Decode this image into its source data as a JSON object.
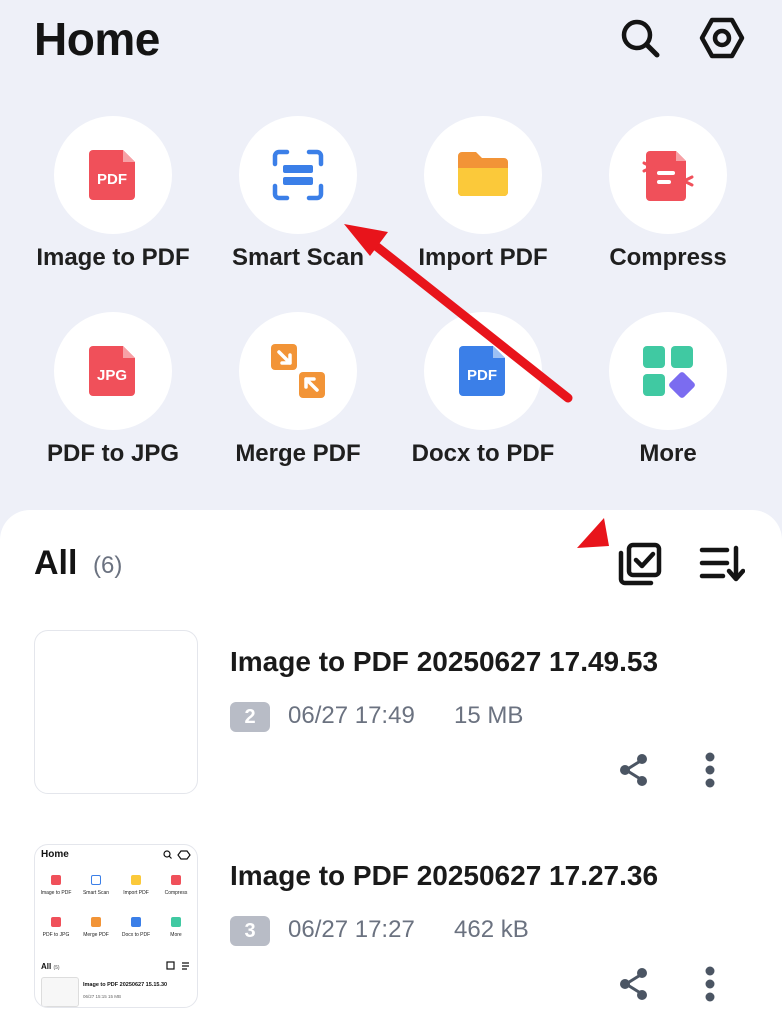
{
  "header": {
    "title": "Home",
    "search_icon": "search-icon",
    "settings_icon": "hexagon-gear-icon"
  },
  "tools": [
    {
      "label": "Image to PDF",
      "icon": "pdf-file-icon",
      "color": "#f0505a"
    },
    {
      "label": "Smart Scan",
      "icon": "scan-frame-icon",
      "color": "#3b7fe8"
    },
    {
      "label": "Import PDF",
      "icon": "folder-icon",
      "color": "#f7b733"
    },
    {
      "label": "Compress",
      "icon": "compress-file-icon",
      "color": "#f0505a"
    },
    {
      "label": "PDF to JPG",
      "icon": "jpg-file-icon",
      "color": "#f0505a"
    },
    {
      "label": "Merge PDF",
      "icon": "merge-arrows-icon",
      "color": "#f29437"
    },
    {
      "label": "Docx to PDF",
      "icon": "pdf-doc-icon",
      "color": "#3b7fe8"
    },
    {
      "label": "More",
      "icon": "grid-more-icon",
      "color": "#40c9a2"
    }
  ],
  "tool_icon_text": {
    "pdf": "PDF",
    "jpg": "JPG"
  },
  "files_section": {
    "title": "All",
    "count": "(6)",
    "select_icon": "multi-select-icon",
    "sort_icon": "sort-icon"
  },
  "files": [
    {
      "name": "Image to PDF 20250627 17.49.53",
      "pages": "2",
      "date": "06/27 17:49",
      "size": "15 MB"
    },
    {
      "name": "Image to PDF 20250627 17.27.36",
      "pages": "3",
      "date": "06/27 17:27",
      "size": "462 kB"
    }
  ],
  "mini_thumbnail": {
    "title": "Home",
    "tools": [
      "Image to PDF",
      "Smart Scan",
      "Import PDF",
      "Compress",
      "PDF to JPG",
      "Merge PDF",
      "Docx to PDF",
      "More"
    ],
    "all_label": "All",
    "all_count": "(5)",
    "file_name": "Image to PDF 20250627 15.15.30",
    "file_meta": "06/27 15:15   15 MB"
  },
  "colors": {
    "background": "#eef0f8",
    "panel": "#ffffff",
    "annotation_red": "#e8141b",
    "badge_gray": "#b8bcc6",
    "meta_gray": "#6b7280"
  }
}
